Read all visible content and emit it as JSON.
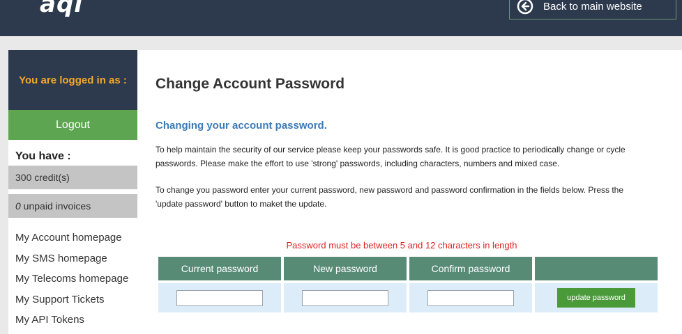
{
  "header": {
    "logo_text": "aqi",
    "back_label": "Back to main website"
  },
  "sidebar": {
    "logged_in_label": "You are logged in as :",
    "logout_label": "Logout",
    "you_have_label": "You have :",
    "credits": "300 credit(s)",
    "unpaid_count": "0",
    "unpaid_label": " unpaid invoices",
    "nav": [
      {
        "label": "My Account homepage"
      },
      {
        "label": "My SMS homepage"
      },
      {
        "label": "My Telecoms homepage"
      },
      {
        "label": "My Support Tickets"
      },
      {
        "label": "My API Tokens"
      }
    ]
  },
  "main": {
    "title": "Change Account Password",
    "subtitle": "Changing your account password.",
    "para1": "To help maintain the security of our service please keep your passwords safe. It is good practice to periodically change or cycle passwords. Please make the effort to use 'strong' passwords, including characters, numbers and mixed case.",
    "para2": "To change you password enter your current password, new password and password confirmation in the fields below. Press the 'update password' button to maket the update.",
    "pw_note": "Password must be between 5 and 12 characters in length",
    "columns": [
      "Current password",
      "New password",
      "Confirm password",
      ""
    ],
    "fields": {
      "current_value": "",
      "new_value": "",
      "confirm_value": ""
    },
    "update_label": "update password"
  },
  "colors": {
    "header_bg": "#2d3a4e",
    "accent_orange": "#f2a826",
    "logout_green": "#5da550",
    "table_header": "#588b76",
    "link_blue": "#3b7ab8",
    "warning_red": "#e02020"
  }
}
